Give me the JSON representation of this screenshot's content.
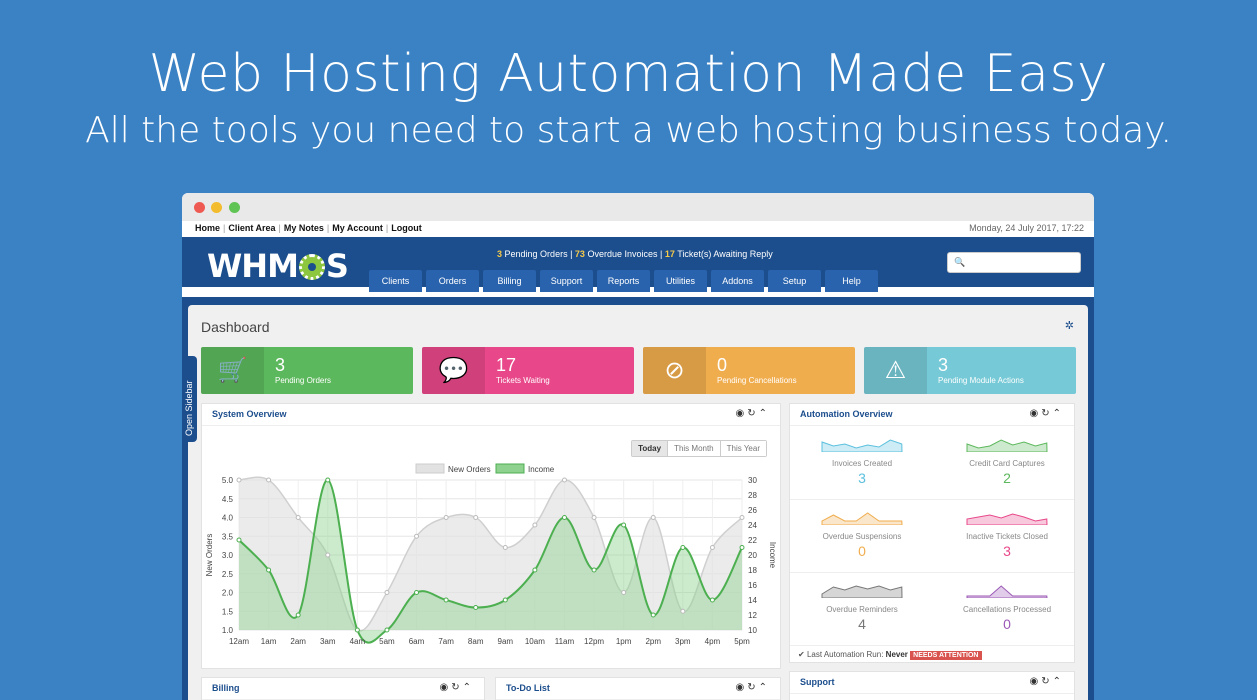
{
  "hero": {
    "title": "Web Hosting Automation Made Easy",
    "subtitle": "All the tools you need to start a web hosting business today."
  },
  "topbar": {
    "links": [
      "Home",
      "Client Area",
      "My Notes",
      "My Account",
      "Logout"
    ],
    "date": "Monday, 24 July 2017, 17:22"
  },
  "header": {
    "logo_pre": "WHM",
    "logo_post": "S",
    "alerts": {
      "pending_orders_n": "3",
      "pending_orders_t": "Pending Orders",
      "overdue_n": "73",
      "overdue_t": "Overdue Invoices",
      "tickets_n": "17",
      "tickets_t": "Ticket(s) Awaiting Reply"
    },
    "search_placeholder": "",
    "nav": [
      "Clients",
      "Orders",
      "Billing",
      "Support",
      "Reports",
      "Utilities",
      "Addons",
      "Setup",
      "Help"
    ]
  },
  "sidebar_tab": "Open Sidebar",
  "dashboard": {
    "title": "Dashboard",
    "stats": [
      {
        "value": "3",
        "label": "Pending Orders",
        "color": "#5cb85c",
        "icon": "cart-icon"
      },
      {
        "value": "17",
        "label": "Tickets Waiting",
        "color": "#e8488a",
        "icon": "chat-icon"
      },
      {
        "value": "0",
        "label": "Pending Cancellations",
        "color": "#f0ad4e",
        "icon": "ban-icon"
      },
      {
        "value": "3",
        "label": "Pending Module Actions",
        "color": "#76c9d6",
        "icon": "warning-icon"
      }
    ],
    "system_overview": {
      "title": "System Overview",
      "ranges": [
        "Today",
        "This Month",
        "This Year"
      ]
    },
    "automation": {
      "title": "Automation Overview",
      "items": [
        {
          "label": "Invoices Created",
          "value": "3",
          "color": "#5bc0de"
        },
        {
          "label": "Credit Card Captures",
          "value": "2",
          "color": "#5cb85c"
        },
        {
          "label": "Overdue Suspensions",
          "value": "0",
          "color": "#f0ad4e"
        },
        {
          "label": "Inactive Tickets Closed",
          "value": "3",
          "color": "#e8488a"
        },
        {
          "label": "Overdue Reminders",
          "value": "4",
          "color": "#777777"
        },
        {
          "label": "Cancellations Processed",
          "value": "0",
          "color": "#9b59b6"
        }
      ],
      "last_run_label": "Last Automation Run:",
      "last_run_value": "Never",
      "badge": "NEEDS ATTENTION"
    },
    "bottom": {
      "billing": "Billing",
      "todo": "To-Do List",
      "support": "Support"
    }
  },
  "chart_data": {
    "type": "area",
    "x": [
      "12am",
      "1am",
      "2am",
      "3am",
      "4am",
      "5am",
      "6am",
      "7am",
      "8am",
      "9am",
      "10am",
      "11am",
      "12pm",
      "1pm",
      "2pm",
      "3pm",
      "4pm",
      "5pm"
    ],
    "series": [
      {
        "name": "New Orders",
        "axis": "left",
        "color": "#dddddd",
        "values": [
          5.0,
          5.0,
          4.0,
          3.0,
          1.0,
          2.0,
          3.5,
          4.0,
          4.0,
          3.2,
          3.8,
          5.0,
          4.0,
          2.0,
          4.0,
          1.5,
          3.2,
          4.0
        ]
      },
      {
        "name": "Income",
        "axis": "right",
        "color": "#6cc36c",
        "values": [
          22,
          18,
          12,
          30,
          10,
          10,
          15,
          14,
          13,
          14,
          18,
          25,
          18,
          24,
          12,
          21,
          14,
          21
        ]
      }
    ],
    "ylabel": "New Orders",
    "y2label": "Income",
    "ylim": [
      1.0,
      5.0
    ],
    "y2lim": [
      10,
      30
    ],
    "yticks": [
      "5.0",
      "4.5",
      "4.0",
      "3.5",
      "3.0",
      "2.5",
      "2.0",
      "1.5",
      "1.0"
    ],
    "y2ticks": [
      "30",
      "28",
      "26",
      "24",
      "22",
      "20",
      "18",
      "16",
      "14",
      "12",
      "10"
    ],
    "legend": "top-center",
    "grid": true
  }
}
